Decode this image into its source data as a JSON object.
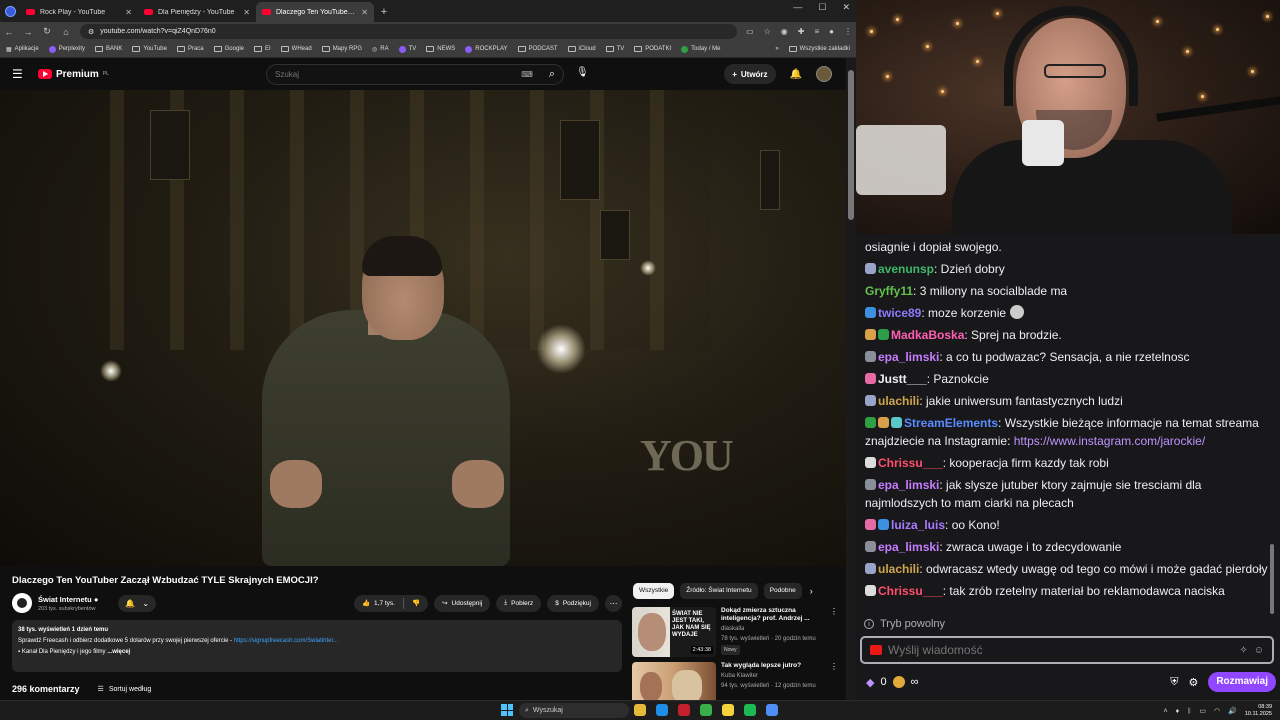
{
  "browser": {
    "tabs": [
      {
        "title": "Rock Play - YouTube",
        "active": false
      },
      {
        "title": "Dla Pieniędzy - YouTube",
        "active": false
      },
      {
        "title": "Dlaczego Ten YouTuber Zaczął",
        "active": true
      }
    ],
    "url": "youtube.com/watch?v=qiZ4QnD76n0",
    "bookmarks": [
      "Aplikacje",
      "Perplexity",
      "BANK",
      "YouTube",
      "Praca",
      "Google",
      "EI",
      "WHead",
      "Mapy RPG",
      "RA",
      "TV",
      "NEWS",
      "ROCKPLAY",
      "PODCAST",
      "iCloud",
      "TV",
      "PODATKI",
      "Today / Me"
    ],
    "bookmarks_all": "Wszystkie zakładki"
  },
  "youtube": {
    "logo_text": "Premium",
    "logo_suffix": "PL",
    "search_placeholder": "Szukaj",
    "create_label": "Utwórz",
    "video": {
      "title": "Dlaczego Ten YouTuber Zaczął Wzbudzać TYLE Skrajnych EMOCJI?",
      "overlay_text": "YOU"
    },
    "channel": {
      "name": "Świat Internetu",
      "subs": "203 tys. subskrybentów"
    },
    "actions": {
      "likes": "1,7 tys.",
      "share": "Udostępnij",
      "download": "Pobierz",
      "thanks": "Podziękuj"
    },
    "description": {
      "stats": "38 tys. wyświetleń  1 dzień temu",
      "line1": "Sprawdź Freecash i odbierz dodatkowe 5 dolarów przy swojej pierwszej ofercie - ",
      "link": "https://signupfreecash.com/Swiatinter...",
      "line2": "Kanał Dla Pieniędzy i jego filmy",
      "more": "...więcej"
    },
    "comments": {
      "count": "296 komentarzy",
      "sort": "Sortuj według"
    },
    "chips": [
      "Wszystkie",
      "Źródło: Świat Internetu",
      "Podobne"
    ],
    "recommendations": [
      {
        "title": "Dokąd zmierza sztuczna inteligencja? prof. Andrzej ...",
        "channel": "dlaskalla",
        "meta": "78 tys. wyświetleń · 20 godzin temu",
        "badge": "Nowy",
        "duration": "2:43:38",
        "thumb_text": "ŚWIAT NIE JEST TAKI, JAK NAM SIĘ WYDAJE"
      },
      {
        "title": "Tak wygląda lepsze jutro?",
        "channel": "Kuba Klawiter",
        "meta": "94 tys. wyświetleń · 12 godzin temu",
        "badge": "",
        "duration": "",
        "thumb_text": ""
      }
    ]
  },
  "chat": {
    "messages": [
      {
        "user": "",
        "color": "#efeff1",
        "text": "osiagnie i dopiał swojego.",
        "badges": []
      },
      {
        "user": "avenunsp",
        "color": "#3eb86b",
        "text": ": Dzień dobry",
        "badges": [
          "#9aa4c8"
        ]
      },
      {
        "user": "Gryffy11",
        "color": "#64c24b",
        "text": ": 3 miliony na socialblade ma",
        "badges": []
      },
      {
        "user": "twice89",
        "color": "#8b7bff",
        "text": ": moze korzenie",
        "badges": [
          "#3d8fe0"
        ],
        "emote": true
      },
      {
        "user": "MadkaBoska",
        "color": "#ff5fb0",
        "text": ": Sprej na brodzie.",
        "badges": [
          "#d9a04a",
          "#2e9d4a"
        ]
      },
      {
        "user": "epa_limski",
        "color": "#c77dff",
        "text": ": a co tu podwazac? Sensacja, a nie rzetelnosc",
        "badges": [
          "#8a8f99"
        ]
      },
      {
        "user": "Justt___",
        "color": "#efeff1",
        "text": ": Paznokcie",
        "badges": [
          "#e86aa4"
        ]
      },
      {
        "user": "ulachili",
        "color": "#d2a44a",
        "text": ": jakie uniwersum fantastycznych ludzi",
        "badges": [
          "#9aa4c8"
        ]
      },
      {
        "user": "StreamElements",
        "color": "#5b8cff",
        "text": ": Wszystkie bieżące informacje na temat streama znajdziecie na Instagramie: ",
        "badges": [
          "#2ea043",
          "#d9a04a",
          "#5ac8c8"
        ],
        "link": "https://www.instagram.com/jarockie/"
      },
      {
        "user": "Chrissu___",
        "color": "#ff4f6d",
        "text": ": kooperacja firm kazdy tak robi",
        "badges": [
          "#dddddd"
        ]
      },
      {
        "user": "epa_limski",
        "color": "#c77dff",
        "text": ": jak slysze jutuber ktory zajmuje sie tresciami dla najmlodszych to mam ciarki na plecach",
        "badges": [
          "#8a8f99"
        ]
      },
      {
        "user": "luiza_luis",
        "color": "#a87cff",
        "text": ": oo Kono!",
        "badges": [
          "#e86aa4",
          "#3d8fe0"
        ]
      },
      {
        "user": "epa_limski",
        "color": "#c77dff",
        "text": ": zwraca uwage i to zdecydowanie",
        "badges": [
          "#8a8f99"
        ]
      },
      {
        "user": "ulachili",
        "color": "#d2a44a",
        "text": ": odwracasz wtedy uwagę od tego co mówi i może gadać pierdoły",
        "badges": [
          "#9aa4c8"
        ]
      },
      {
        "user": "Chrissu___",
        "color": "#ff4f6d",
        "text": ": tak zrób rzetelny materiał bo reklamodawca naciska",
        "badges": [
          "#dddddd"
        ]
      }
    ],
    "slow_mode": "Tryb powolny",
    "input_placeholder": "Wyślij wiadomość",
    "points": "0",
    "chat_button": "Rozmawiaj"
  },
  "taskbar": {
    "search": "Wyszukaj",
    "time": "08:39",
    "date": "10.11.2025"
  }
}
